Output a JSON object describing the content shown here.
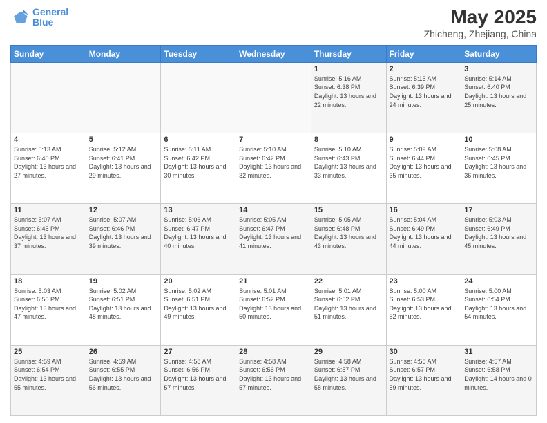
{
  "header": {
    "logo_line1": "General",
    "logo_line2": "Blue",
    "title": "May 2025",
    "subtitle": "Zhicheng, Zhejiang, China"
  },
  "weekdays": [
    "Sunday",
    "Monday",
    "Tuesday",
    "Wednesday",
    "Thursday",
    "Friday",
    "Saturday"
  ],
  "weeks": [
    [
      {
        "day": "",
        "sunrise": "",
        "sunset": "",
        "daylight": ""
      },
      {
        "day": "",
        "sunrise": "",
        "sunset": "",
        "daylight": ""
      },
      {
        "day": "",
        "sunrise": "",
        "sunset": "",
        "daylight": ""
      },
      {
        "day": "",
        "sunrise": "",
        "sunset": "",
        "daylight": ""
      },
      {
        "day": "1",
        "sunrise": "Sunrise: 5:16 AM",
        "sunset": "Sunset: 6:38 PM",
        "daylight": "Daylight: 13 hours and 22 minutes."
      },
      {
        "day": "2",
        "sunrise": "Sunrise: 5:15 AM",
        "sunset": "Sunset: 6:39 PM",
        "daylight": "Daylight: 13 hours and 24 minutes."
      },
      {
        "day": "3",
        "sunrise": "Sunrise: 5:14 AM",
        "sunset": "Sunset: 6:40 PM",
        "daylight": "Daylight: 13 hours and 25 minutes."
      }
    ],
    [
      {
        "day": "4",
        "sunrise": "Sunrise: 5:13 AM",
        "sunset": "Sunset: 6:40 PM",
        "daylight": "Daylight: 13 hours and 27 minutes."
      },
      {
        "day": "5",
        "sunrise": "Sunrise: 5:12 AM",
        "sunset": "Sunset: 6:41 PM",
        "daylight": "Daylight: 13 hours and 29 minutes."
      },
      {
        "day": "6",
        "sunrise": "Sunrise: 5:11 AM",
        "sunset": "Sunset: 6:42 PM",
        "daylight": "Daylight: 13 hours and 30 minutes."
      },
      {
        "day": "7",
        "sunrise": "Sunrise: 5:10 AM",
        "sunset": "Sunset: 6:42 PM",
        "daylight": "Daylight: 13 hours and 32 minutes."
      },
      {
        "day": "8",
        "sunrise": "Sunrise: 5:10 AM",
        "sunset": "Sunset: 6:43 PM",
        "daylight": "Daylight: 13 hours and 33 minutes."
      },
      {
        "day": "9",
        "sunrise": "Sunrise: 5:09 AM",
        "sunset": "Sunset: 6:44 PM",
        "daylight": "Daylight: 13 hours and 35 minutes."
      },
      {
        "day": "10",
        "sunrise": "Sunrise: 5:08 AM",
        "sunset": "Sunset: 6:45 PM",
        "daylight": "Daylight: 13 hours and 36 minutes."
      }
    ],
    [
      {
        "day": "11",
        "sunrise": "Sunrise: 5:07 AM",
        "sunset": "Sunset: 6:45 PM",
        "daylight": "Daylight: 13 hours and 37 minutes."
      },
      {
        "day": "12",
        "sunrise": "Sunrise: 5:07 AM",
        "sunset": "Sunset: 6:46 PM",
        "daylight": "Daylight: 13 hours and 39 minutes."
      },
      {
        "day": "13",
        "sunrise": "Sunrise: 5:06 AM",
        "sunset": "Sunset: 6:47 PM",
        "daylight": "Daylight: 13 hours and 40 minutes."
      },
      {
        "day": "14",
        "sunrise": "Sunrise: 5:05 AM",
        "sunset": "Sunset: 6:47 PM",
        "daylight": "Daylight: 13 hours and 41 minutes."
      },
      {
        "day": "15",
        "sunrise": "Sunrise: 5:05 AM",
        "sunset": "Sunset: 6:48 PM",
        "daylight": "Daylight: 13 hours and 43 minutes."
      },
      {
        "day": "16",
        "sunrise": "Sunrise: 5:04 AM",
        "sunset": "Sunset: 6:49 PM",
        "daylight": "Daylight: 13 hours and 44 minutes."
      },
      {
        "day": "17",
        "sunrise": "Sunrise: 5:03 AM",
        "sunset": "Sunset: 6:49 PM",
        "daylight": "Daylight: 13 hours and 45 minutes."
      }
    ],
    [
      {
        "day": "18",
        "sunrise": "Sunrise: 5:03 AM",
        "sunset": "Sunset: 6:50 PM",
        "daylight": "Daylight: 13 hours and 47 minutes."
      },
      {
        "day": "19",
        "sunrise": "Sunrise: 5:02 AM",
        "sunset": "Sunset: 6:51 PM",
        "daylight": "Daylight: 13 hours and 48 minutes."
      },
      {
        "day": "20",
        "sunrise": "Sunrise: 5:02 AM",
        "sunset": "Sunset: 6:51 PM",
        "daylight": "Daylight: 13 hours and 49 minutes."
      },
      {
        "day": "21",
        "sunrise": "Sunrise: 5:01 AM",
        "sunset": "Sunset: 6:52 PM",
        "daylight": "Daylight: 13 hours and 50 minutes."
      },
      {
        "day": "22",
        "sunrise": "Sunrise: 5:01 AM",
        "sunset": "Sunset: 6:52 PM",
        "daylight": "Daylight: 13 hours and 51 minutes."
      },
      {
        "day": "23",
        "sunrise": "Sunrise: 5:00 AM",
        "sunset": "Sunset: 6:53 PM",
        "daylight": "Daylight: 13 hours and 52 minutes."
      },
      {
        "day": "24",
        "sunrise": "Sunrise: 5:00 AM",
        "sunset": "Sunset: 6:54 PM",
        "daylight": "Daylight: 13 hours and 54 minutes."
      }
    ],
    [
      {
        "day": "25",
        "sunrise": "Sunrise: 4:59 AM",
        "sunset": "Sunset: 6:54 PM",
        "daylight": "Daylight: 13 hours and 55 minutes."
      },
      {
        "day": "26",
        "sunrise": "Sunrise: 4:59 AM",
        "sunset": "Sunset: 6:55 PM",
        "daylight": "Daylight: 13 hours and 56 minutes."
      },
      {
        "day": "27",
        "sunrise": "Sunrise: 4:58 AM",
        "sunset": "Sunset: 6:56 PM",
        "daylight": "Daylight: 13 hours and 57 minutes."
      },
      {
        "day": "28",
        "sunrise": "Sunrise: 4:58 AM",
        "sunset": "Sunset: 6:56 PM",
        "daylight": "Daylight: 13 hours and 57 minutes."
      },
      {
        "day": "29",
        "sunrise": "Sunrise: 4:58 AM",
        "sunset": "Sunset: 6:57 PM",
        "daylight": "Daylight: 13 hours and 58 minutes."
      },
      {
        "day": "30",
        "sunrise": "Sunrise: 4:58 AM",
        "sunset": "Sunset: 6:57 PM",
        "daylight": "Daylight: 13 hours and 59 minutes."
      },
      {
        "day": "31",
        "sunrise": "Sunrise: 4:57 AM",
        "sunset": "Sunset: 6:58 PM",
        "daylight": "Daylight: 14 hours and 0 minutes."
      }
    ]
  ]
}
